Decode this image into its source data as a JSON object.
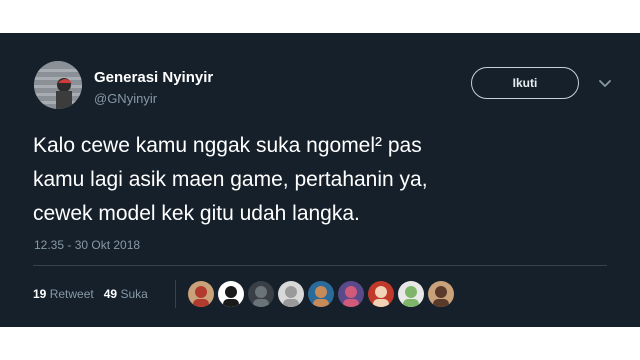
{
  "user": {
    "name": "Generasi Nyinyir",
    "handle": "@GNyinyir"
  },
  "follow_button": {
    "label": "Ikuti"
  },
  "tweet": {
    "text": "Kalo cewe kamu nggak suka ngomel² pas\nkamu lagi asik maen game, pertahanin ya,\ncewek model kek gitu udah langka.",
    "timestamp": "12.35 - 30 Okt 2018"
  },
  "stats": {
    "retweets_count": "19",
    "retweets_label": "Retweet",
    "likes_count": "49",
    "likes_label": "Suka"
  },
  "liker_avatars": [
    {
      "colors": [
        "#c9a27a",
        "#b33a2f"
      ]
    },
    {
      "colors": [
        "#ffffff",
        "#1a1a1a"
      ]
    },
    {
      "colors": [
        "#3a3f45",
        "#6b737a"
      ]
    },
    {
      "colors": [
        "#d8d8d8",
        "#9a9a9a"
      ]
    },
    {
      "colors": [
        "#2a6b9a",
        "#c98a5a"
      ]
    },
    {
      "colors": [
        "#5a4a8a",
        "#d05a7a"
      ]
    },
    {
      "colors": [
        "#c0392b",
        "#f2d2b6"
      ]
    },
    {
      "colors": [
        "#e8e8e8",
        "#7fb56a"
      ]
    },
    {
      "colors": [
        "#c9a27a",
        "#5a3a2a"
      ]
    }
  ],
  "colors": {
    "background": "#15202b",
    "secondary_text": "#8899a6",
    "divider": "#38444d"
  }
}
